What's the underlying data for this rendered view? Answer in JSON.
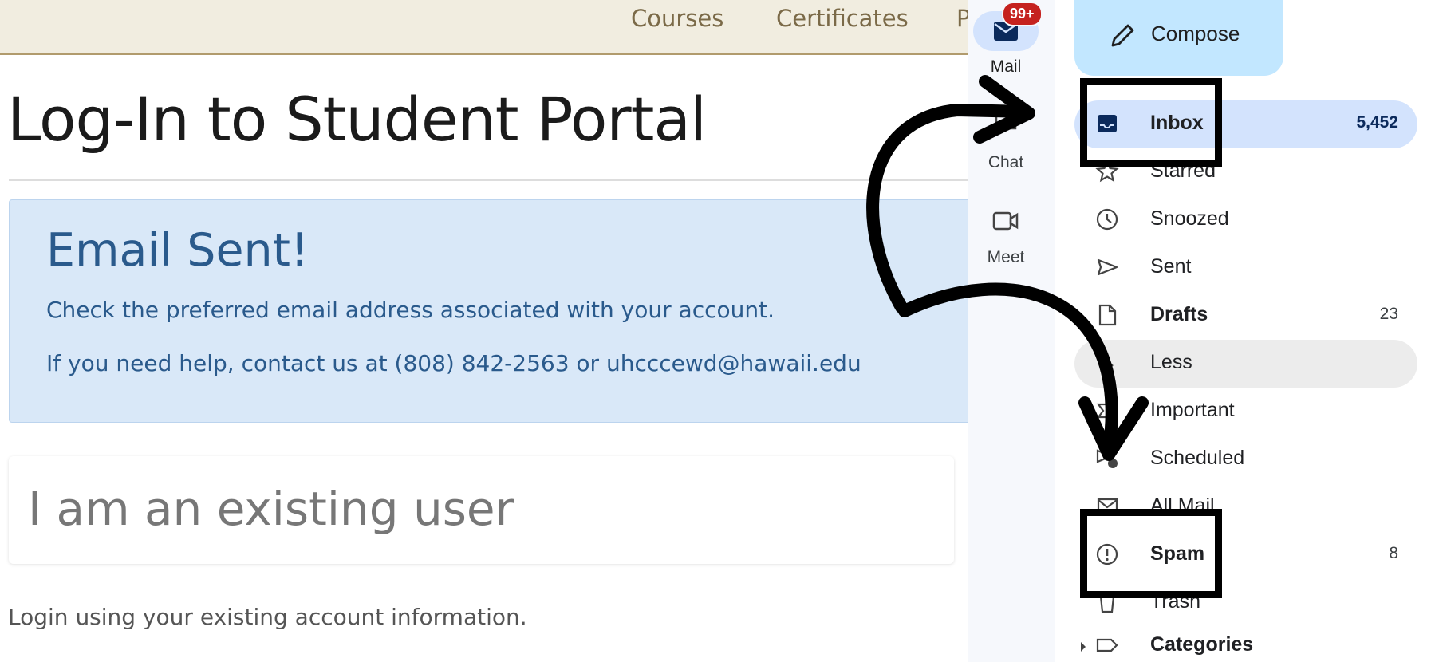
{
  "portal": {
    "nav": {
      "courses": "Courses",
      "certificates": "Certificates",
      "partial": "P"
    },
    "title": "Log-In to Student Portal",
    "alert": {
      "title": "Email Sent!",
      "line1": "Check the preferred email address associated with your account.",
      "line2": "If you need help, contact us at (808) 842-2563 or uhcccewd@hawaii.edu"
    },
    "existing_user_title": "I am an existing user",
    "login_hint": "Login using your existing account information."
  },
  "gmail": {
    "rail": {
      "mail_badge": "99+",
      "mail_label": "Mail",
      "chat_label": "Chat",
      "meet_label": "Meet"
    },
    "compose_label": "Compose",
    "folders": [
      {
        "label": "Inbox",
        "count": "5,452",
        "icon": "inbox-icon"
      },
      {
        "label": "Starred",
        "count": "",
        "icon": "star-icon"
      },
      {
        "label": "Snoozed",
        "count": "",
        "icon": "clock-icon"
      },
      {
        "label": "Sent",
        "count": "",
        "icon": "send-icon"
      },
      {
        "label": "Drafts",
        "count": "23",
        "icon": "draft-icon"
      },
      {
        "label": "Less",
        "count": "",
        "icon": "chevron-up-icon"
      },
      {
        "label": "Important",
        "count": "",
        "icon": "important-icon"
      },
      {
        "label": "Scheduled",
        "count": "",
        "icon": "scheduled-icon"
      },
      {
        "label": "All Mail",
        "count": "",
        "icon": "all-mail-icon"
      },
      {
        "label": "Spam",
        "count": "8",
        "icon": "spam-icon"
      },
      {
        "label": "Trash",
        "count": "",
        "icon": "trash-icon"
      },
      {
        "label": "Categories",
        "count": "",
        "icon": "label-icon"
      }
    ]
  },
  "colors": {
    "portal_nav_bg": "#f1ede0",
    "alert_bg": "#d9e8f8",
    "alert_text": "#2a5a8c",
    "gmail_selected": "#d3e3fd",
    "compose_bg": "#c2e7ff",
    "badge": "#c5221f",
    "annotation": "#000000"
  }
}
